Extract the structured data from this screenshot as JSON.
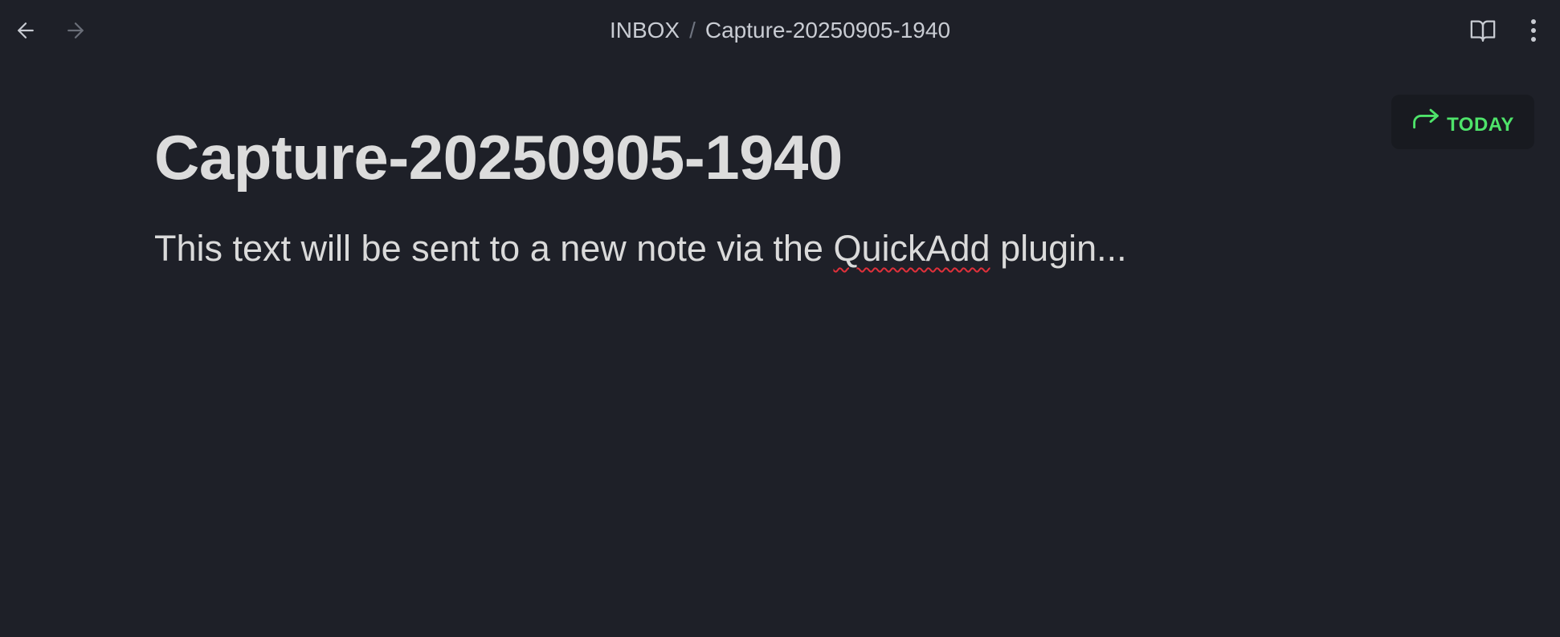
{
  "header": {
    "breadcrumb": {
      "folder": "INBOX",
      "separator": "/",
      "file": "Capture-20250905-1940"
    },
    "icons": {
      "back": "arrow-left-icon",
      "forward": "arrow-right-icon",
      "reading_view": "book-open-icon",
      "more": "more-vertical-icon"
    }
  },
  "today_button": {
    "label": "TODAY",
    "icon": "redo-arrow-icon",
    "color": "#4ee36a"
  },
  "note": {
    "title": "Capture-20250905-1940",
    "body_before": "This text will be sent to a new note via the ",
    "body_misspelled": "QuickAdd",
    "body_after": " plugin..."
  },
  "colors": {
    "background": "#1e2028",
    "text": "#dadada",
    "accent": "#4ee36a",
    "spellcheck": "#e0303a"
  }
}
